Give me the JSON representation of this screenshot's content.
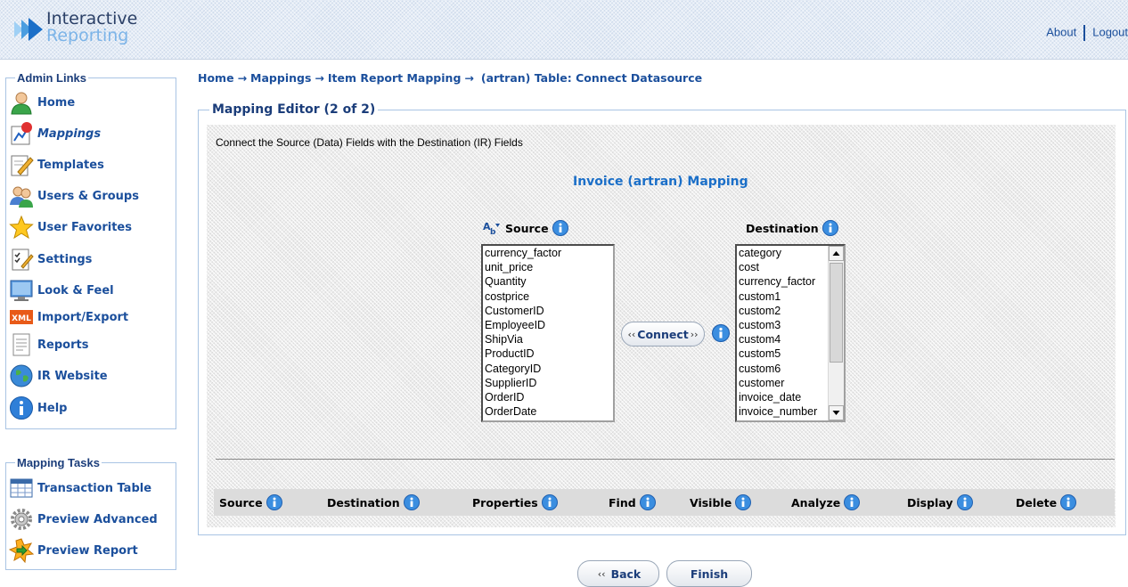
{
  "header": {
    "logo_line1": "Interactive",
    "logo_line2": "Reporting",
    "links": {
      "about": "About",
      "logout": "Logout"
    }
  },
  "admin_links": {
    "title": "Admin Links",
    "items": [
      {
        "label": "Home",
        "icon": "home-person-icon"
      },
      {
        "label": "Mappings",
        "icon": "mappings-chart-icon",
        "active": true
      },
      {
        "label": "Templates",
        "icon": "templates-pencil-icon"
      },
      {
        "label": "Users & Groups",
        "icon": "users-icon"
      },
      {
        "label": "User Favorites",
        "icon": "star-icon"
      },
      {
        "label": "Settings",
        "icon": "settings-checklist-icon"
      },
      {
        "label": "Look & Feel",
        "icon": "monitor-icon"
      },
      {
        "label": "Import/Export",
        "icon": "xml-icon"
      },
      {
        "label": "Reports",
        "icon": "report-document-icon"
      },
      {
        "label": "IR Website",
        "icon": "globe-icon"
      },
      {
        "label": "Help",
        "icon": "info-icon"
      }
    ]
  },
  "mapping_tasks": {
    "title": "Mapping Tasks",
    "items": [
      {
        "label": "Transaction Table",
        "icon": "table-icon"
      },
      {
        "label": "Preview Advanced",
        "icon": "gear-icon"
      },
      {
        "label": "Preview Report",
        "icon": "preview-report-icon"
      }
    ]
  },
  "breadcrumb": {
    "items": [
      "Home",
      "Mappings",
      "Item Report Mapping",
      "(artran) Table: Connect Datasource"
    ],
    "separator": "→"
  },
  "editor": {
    "legend": "Mapping Editor (2 of 2)",
    "instructions": "Connect the Source (Data) Fields with the Destination (IR) Fields",
    "title": "Invoice (artran) Mapping",
    "source_label": "Source",
    "destination_label": "Destination",
    "source_fields": [
      "currency_factor",
      "unit_price",
      "Quantity",
      "costprice",
      "CustomerID",
      "EmployeeID",
      "ShipVia",
      "ProductID",
      "CategoryID",
      "SupplierID",
      "OrderID",
      "OrderDate"
    ],
    "destination_fields": [
      "category",
      "cost",
      "currency_factor",
      "custom1",
      "custom2",
      "custom3",
      "custom4",
      "custom5",
      "custom6",
      "customer",
      "invoice_date",
      "invoice_number"
    ],
    "connect_label": "Connect",
    "grid_columns": [
      "Source",
      "Destination",
      "Properties",
      "Find",
      "Visible",
      "Analyze",
      "Display",
      "Delete"
    ]
  },
  "footer": {
    "back_label": "Back",
    "finish_label": "Finish"
  },
  "colors": {
    "link_blue": "#1b4f9c",
    "title_blue": "#1b6fc8",
    "panel_border": "#a9c4e4"
  }
}
